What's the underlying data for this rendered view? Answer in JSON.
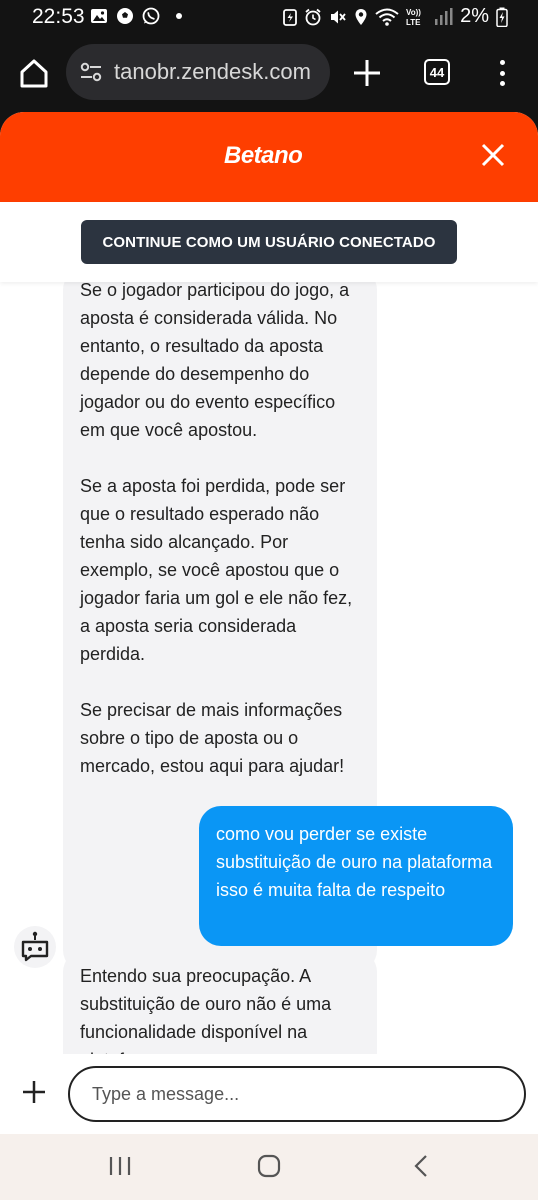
{
  "status_bar": {
    "time": "22:53",
    "battery": "2%"
  },
  "browser": {
    "url": "tanobr.zendesk.com",
    "tab_count": "44"
  },
  "widget": {
    "brand": "Betano",
    "auth_button": "CONTINUE COMO UM USUÁRIO CONECTADO"
  },
  "messages": [
    {
      "sender": "bot",
      "paragraphs": [
        "Se o jogador participou do jogo, a aposta é considerada válida. No entanto, o resultado da aposta depende do desempenho do jogador ou do evento específico em que você apostou.",
        "Se a aposta foi perdida, pode ser que o resultado esperado não tenha sido alcançado. Por exemplo, se você apostou que o jogador faria um gol e ele não fez, a aposta seria considerada perdida.",
        "Se precisar de mais informações sobre o tipo de aposta ou o mercado, estou aqui para ajudar!"
      ]
    },
    {
      "sender": "user",
      "text": "como vou perder se existe substituição de ouro na plataforma isso é muita falta de respeito"
    },
    {
      "sender": "bot",
      "text": "Entendo sua preocupação. A substituição de ouro não é uma funcionalidade disponível na plataforma."
    }
  ],
  "composer": {
    "placeholder": "Type a message..."
  },
  "colors": {
    "brand": "#fe3e00",
    "user_bubble": "#0a96f5",
    "bot_bubble": "#f3f3f5",
    "auth_button": "#2c3440"
  }
}
